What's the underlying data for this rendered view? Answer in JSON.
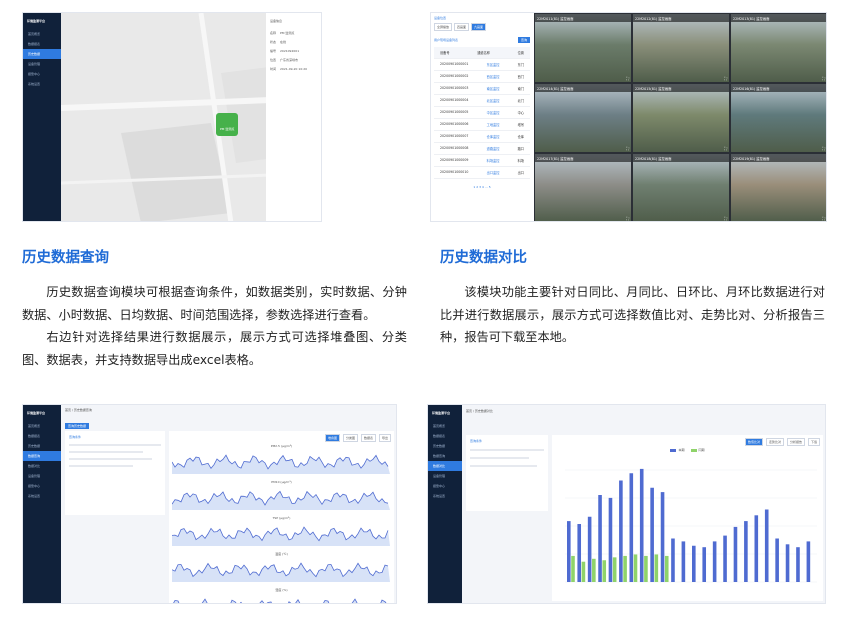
{
  "sections": [
    {
      "title": "历史数据查询",
      "paragraphs": [
        "历史数据查询模块可根据查询条件，如数据类别，实时数据、分钟数据、小时数据、日均数据、时间范围选择，参数选择进行查看。",
        "右边针对选择结果进行数据展示，展示方式可选择堆叠图、分类图、数据表，并支持数据导出成excel表格。"
      ]
    },
    {
      "title": "历史数据对比",
      "paragraphs": [
        "该模块功能主要针对日同比、月同比、日环比、月环比数据进行对比并进行数据展示，展示方式可选择数值比对、走势比对、分析报告三种，报告可下载至本地。"
      ]
    }
  ],
  "screens": {
    "app_name": "环境监测平台",
    "map": {
      "menu": [
        "首页概览",
        "数据报表",
        "历史数据",
        "设备管理",
        "报警中心",
        "系统设置"
      ],
      "info_title": "设备信息",
      "info_rows": [
        [
          "名称",
          "PM 监测点"
        ],
        [
          "状态",
          "在线"
        ],
        [
          "编号",
          "2021092001"
        ],
        [
          "位置",
          "广东省深圳市"
        ],
        [
          "时间",
          "2021-09-20 10:20"
        ]
      ],
      "marker_label": "PM 监测点"
    },
    "video": {
      "panel_title": "设备位置",
      "tabs": [
        "全屏播放",
        "四画面",
        "九画面"
      ],
      "table_title": "用户现场设备列表",
      "search_btn": "查询",
      "columns": [
        "设备号",
        "通道名称",
        "位置"
      ],
      "rows": [
        [
          "20200901000001",
          "东区监控",
          "东门"
        ],
        [
          "20200901000002",
          "西区监控",
          "西门"
        ],
        [
          "20200901000003",
          "南区监控",
          "南门"
        ],
        [
          "20200901000004",
          "北区监控",
          "北门"
        ],
        [
          "20200901000005",
          "中区监控",
          "中心"
        ],
        [
          "20200901000006",
          "工地监控",
          "塔吊"
        ],
        [
          "20200901000007",
          "仓库监控",
          "仓库"
        ],
        [
          "20200901000008",
          "道路监控",
          "路口"
        ],
        [
          "20200901000009",
          "料场监控",
          "料场"
        ],
        [
          "20200901000010",
          "出口监控",
          "出口"
        ]
      ],
      "pager": "1 2 3 4 … 5",
      "cameras": [
        "22M2011(81) 监控画面",
        "22M2012(81) 监控画面",
        "22M2013(81) 监控画面",
        "22M2014(81) 监控画面",
        "22M2015(81) 监控画面",
        "22M2016(81) 监控画面",
        "22M2017(81) 监控画面",
        "22M2018(81) 监控画面",
        "22M2019(81) 监控画面"
      ]
    },
    "history": {
      "breadcrumb": "首页 / 历史数据查询",
      "button": "查询历史数据",
      "menu": [
        "首页概览",
        "数据报表",
        "历史数据",
        "数据查询",
        "数据对比",
        "设备管理",
        "报警中心",
        "系统设置"
      ],
      "query_title": "查询条件",
      "view_options": [
        "堆叠图",
        "分类图",
        "数据表",
        "导出"
      ],
      "chart_titles": [
        "PM2.5 (μg/m³)",
        "PM10 (μg/m³)",
        "TSP (μg/m³)",
        "温度 (℃)",
        "湿度 (%)"
      ]
    },
    "compare": {
      "breadcrumb": "首页 / 历史数据对比",
      "query_title": "查询条件",
      "view_options": [
        "数值比对",
        "走势比对",
        "分析报告",
        "下载"
      ],
      "legend": [
        "本期",
        "同期"
      ],
      "colors": {
        "series_a": "#4f6bd1",
        "series_b": "#8fd36a"
      },
      "bars_a": [
        42,
        40,
        45,
        60,
        58,
        70,
        75,
        78,
        65,
        62,
        30,
        28,
        25,
        24,
        28,
        32,
        38,
        42,
        46,
        50,
        30,
        26,
        24,
        28
      ],
      "bars_b": [
        18,
        14,
        16,
        15,
        17,
        18,
        19,
        18,
        19,
        18,
        0,
        0,
        0,
        0,
        0,
        0,
        0,
        0,
        0,
        0,
        0,
        0,
        0,
        0
      ]
    }
  }
}
